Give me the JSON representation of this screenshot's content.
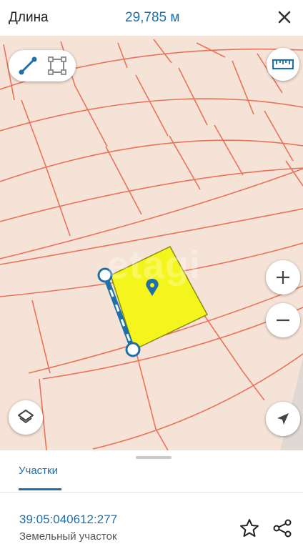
{
  "header": {
    "title": "Длина",
    "value": "29,785 м"
  },
  "sheet": {
    "tab_label": "Участки",
    "parcel_id": "39:05:040612:277",
    "parcel_type": "Земельный участок"
  },
  "watermark": "etagi",
  "colors": {
    "accent": "#1f6fa8",
    "map_bg": "#f6e3d7",
    "parcel_lines": "#e8735a",
    "selected_parcel": "#f5f51e",
    "measure_line": "#1f6fa8"
  },
  "icons": {
    "close": "close-icon",
    "line_tool": "line-measure-icon",
    "area_tool": "area-measure-icon",
    "ruler": "ruler-icon",
    "zoom_in": "plus-icon",
    "zoom_out": "minus-icon",
    "layers": "layers-icon",
    "location": "navigation-arrow-icon",
    "favorite": "star-icon",
    "share": "share-icon"
  }
}
